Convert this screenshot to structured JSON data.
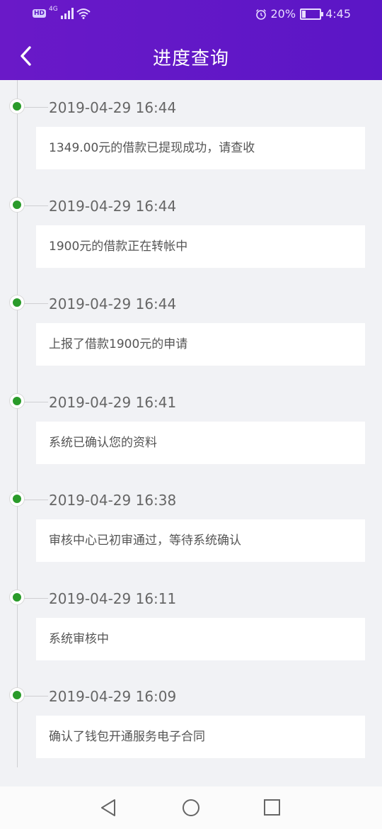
{
  "status_bar": {
    "hd": "HD",
    "network": "4G",
    "battery_percent": "20%",
    "battery_level": 0.2,
    "time": "4:45"
  },
  "header": {
    "title": "进度查询"
  },
  "timeline": [
    {
      "time": "2019-04-29 16:44",
      "message": "1349.00元的借款已提现成功，请查收"
    },
    {
      "time": "2019-04-29 16:44",
      "message": "1900元的借款正在转帐中"
    },
    {
      "time": "2019-04-29 16:44",
      "message": "上报了借款1900元的申请"
    },
    {
      "time": "2019-04-29 16:41",
      "message": "系统已确认您的资料"
    },
    {
      "time": "2019-04-29 16:38",
      "message": "审核中心已初审通过，等待系统确认"
    },
    {
      "time": "2019-04-29 16:11",
      "message": "系统审核中"
    },
    {
      "time": "2019-04-29 16:09",
      "message": "确认了钱包开通服务电子合同"
    }
  ],
  "colors": {
    "header": "#5b16c6",
    "dot": "#2a9b2a",
    "background": "#f1f2f5"
  },
  "icons": {
    "back": "chevron-left-icon",
    "nav_back": "triangle-back-icon",
    "nav_home": "circle-home-icon",
    "nav_recent": "square-recent-icon"
  }
}
